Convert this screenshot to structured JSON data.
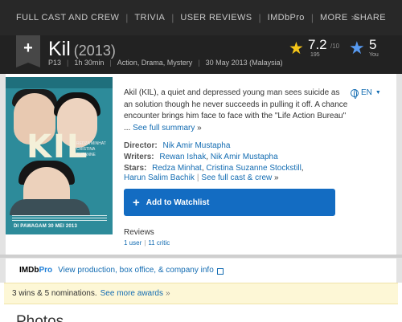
{
  "nav": {
    "items": [
      "FULL CAST AND CREW",
      "TRIVIA",
      "USER REVIEWS",
      "IMDbPro",
      "MORE"
    ],
    "share": "SHARE"
  },
  "title": {
    "name": "Kil",
    "year": "(2013)",
    "certificate": "P13",
    "runtime": "1h 30min",
    "genres": "Action, Drama, Mystery",
    "release": "30 May 2013 (Malaysia)"
  },
  "rating": {
    "score": "7.2",
    "out_of": "/10",
    "votes": "195",
    "user_rating": "5",
    "user_label": "You",
    "star_color": "#f5c518",
    "user_star_color": "#5799ef"
  },
  "poster": {
    "title": "KIL",
    "cast_names": "REDZA MINHAT CRISTINA SUZANNE",
    "release_text": "DI PAWAGAM 30 MEI 2013"
  },
  "plot": {
    "summary": "Akil (KIL), a quiet and depressed young man sees suicide as an solution though he never succeeds in pulling it off. A chance encounter brings him face to face with the \"Life Action Bureau\" ...",
    "see_full": "See full summary",
    "raquo": "»"
  },
  "language": {
    "label": "EN"
  },
  "credits": {
    "director_label": "Director:",
    "director": "Nik Amir Mustapha",
    "writers_label": "Writers:",
    "writer1": "Rewan Ishak",
    "writer2": "Nik Amir Mustapha",
    "stars_label": "Stars:",
    "star1": "Redza Minhat",
    "star2": "Cristina Suzanne Stockstill",
    "star3": "Harun Salim Bachik",
    "see_cast": "See full cast & crew",
    "raquo": "»"
  },
  "watchlist": {
    "label": "Add to Watchlist"
  },
  "reviews": {
    "heading": "Reviews",
    "user": "1 user",
    "critic": "11 critic"
  },
  "pro": {
    "logo_a": "IMDb",
    "logo_b": "Pro",
    "link": "View production, box office, & company info"
  },
  "awards": {
    "text": "3 wins & 5 nominations.",
    "link": "See more awards",
    "raquo": "»"
  },
  "photos": {
    "heading": "Photos"
  },
  "colors": {
    "accent_blue": "#136cb2",
    "button_blue": "#136cc2",
    "header_dark": "#222222",
    "awards_bg": "#fdf7d6"
  }
}
